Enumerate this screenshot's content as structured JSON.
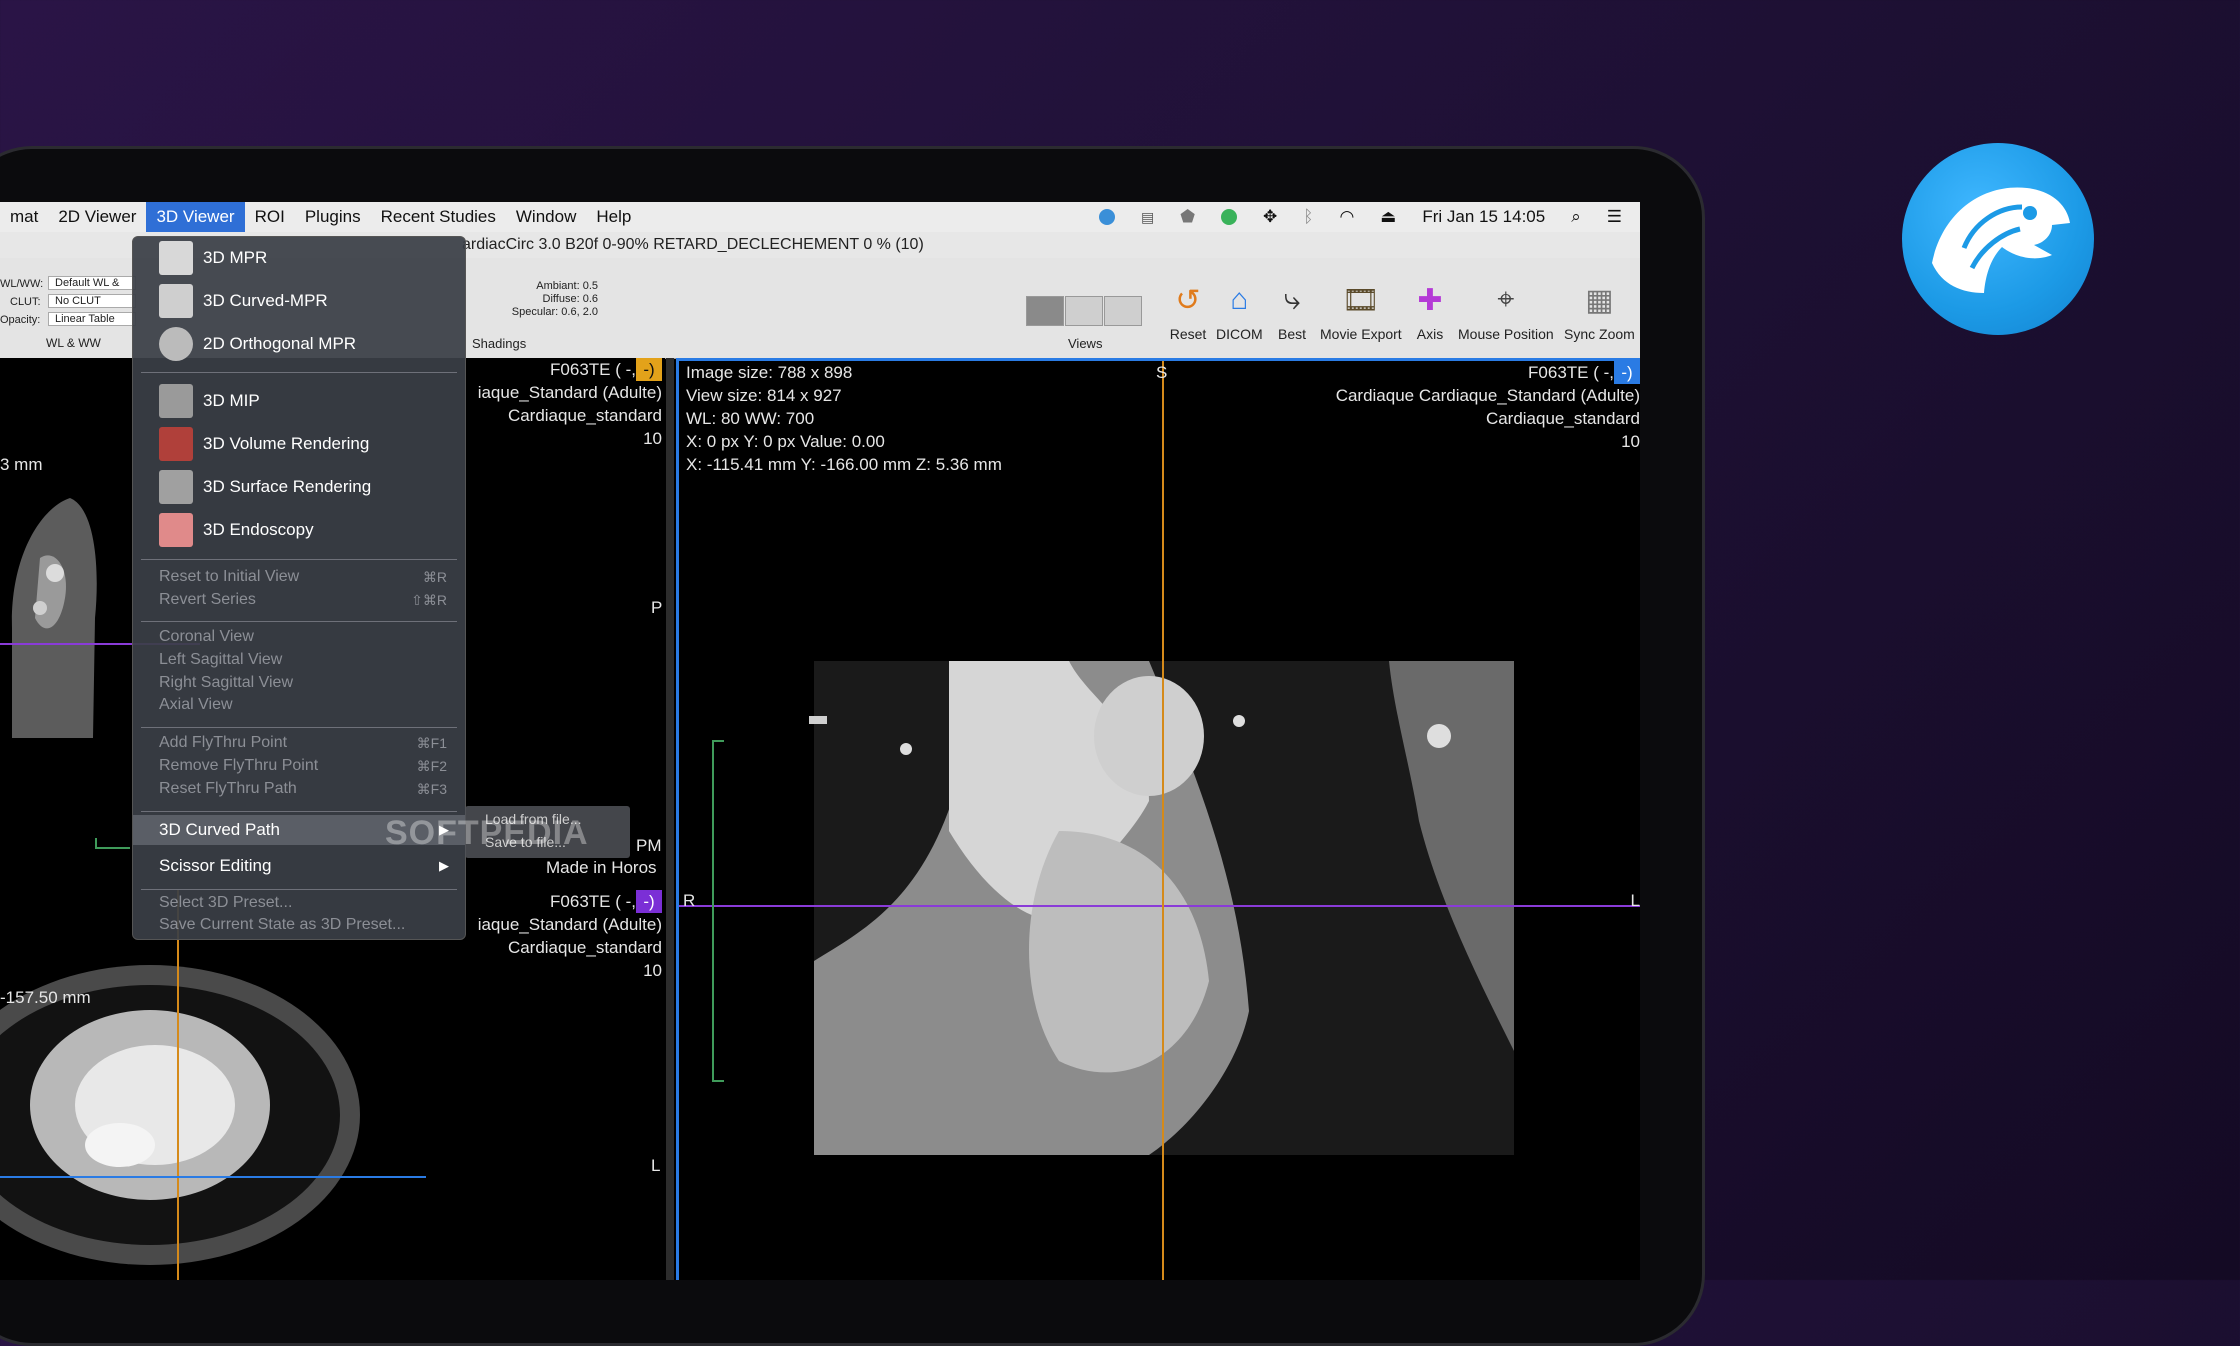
{
  "menubar": {
    "items": [
      "mat",
      "2D Viewer",
      "3D Viewer",
      "ROI",
      "Plugins",
      "Recent Studies",
      "Window",
      "Help"
    ],
    "clock": "Fri Jan 15  14:05"
  },
  "window": {
    "title": "ardiacCirc 3.0 B20f 0-90% RETARD_DECLECHEMENT 0 % (10)"
  },
  "toolbar": {
    "wl_labels": [
      "WL/WW:",
      "CLUT:",
      "Opacity:"
    ],
    "wl_values": [
      "Default WL &",
      "No CLUT",
      "Linear Table"
    ],
    "wl_group": "WL & WW",
    "shading_values": [
      "Ambiant: 0.5",
      "Diffuse: 0.6",
      "Specular: 0.6, 2.0"
    ],
    "shadings_label": "Shadings",
    "views_label": "Views",
    "tools": [
      "Reset",
      "DICOM",
      "Best",
      "Movie Export",
      "Axis",
      "Mouse Position",
      "Sync Zoom"
    ]
  },
  "menu": {
    "items": [
      {
        "label": "3D MPR",
        "color": "#d8d8d8"
      },
      {
        "label": "3D Curved-MPR",
        "color": "#cfcfcf"
      },
      {
        "label": "2D Orthogonal MPR",
        "color": "#bbbbbb"
      },
      {
        "label": "3D MIP",
        "color": "#9a9a9a"
      },
      {
        "label": "3D Volume Rendering",
        "color": "#b0403a"
      },
      {
        "label": "3D Surface Rendering",
        "color": "#a0a0a0"
      },
      {
        "label": "3D Endoscopy",
        "color": "#e08a8a"
      }
    ],
    "reset_initial": "Reset to Initial View",
    "reset_initial_sc": "⌘R",
    "revert_series": "Revert Series",
    "revert_series_sc": "⇧⌘R",
    "coronal": "Coronal View",
    "left_sag": "Left Sagittal View",
    "right_sag": "Right Sagittal View",
    "axial": "Axial View",
    "add_fly": "Add FlyThru Point",
    "add_fly_sc": "⌘F1",
    "remove_fly": "Remove FlyThru Point",
    "remove_fly_sc": "⌘F2",
    "reset_fly": "Reset FlyThru Path",
    "reset_fly_sc": "⌘F3",
    "curved_path": "3D Curved Path",
    "scissor": "Scissor Editing",
    "select_preset": "Select 3D Preset...",
    "save_preset": "Save Current State as 3D Preset..."
  },
  "submenu": {
    "load": "Load from file...",
    "save": "Save to file..."
  },
  "watermark": "SOFTPEDIA",
  "viewer_main": {
    "info": [
      "Image size: 788 x 898",
      "View size: 814 x 927",
      "WL: 80 WW: 700",
      "X: 0 px Y: 0 px Value: 0.00",
      "X: -115.41 mm Y: -166.00 mm Z: 5.36 mm"
    ],
    "right_info": [
      "F063TE (  -,",
      "Cardiaque Cardiaque_Standard (Adulte)",
      "Cardiaque_standard",
      "10"
    ],
    "badge": "-)",
    "top_marker": "S",
    "left_marker": "R",
    "right_marker": "L"
  },
  "viewer_top_left": {
    "info": [
      "F063TE (  -,",
      "iaque_Standard (Adulte)",
      "Cardiaque_standard",
      "10"
    ],
    "badge": "-)",
    "mm": "3 mm",
    "p_marker": "P",
    "pm_marker": "PM",
    "made_in": "Made in Horos"
  },
  "viewer_bottom_left": {
    "info": [
      "F063TE (  -,",
      "iaque_Standard (Adulte)",
      "Cardiaque_standard",
      "10"
    ],
    "badge": "-)",
    "mm": "-157.50 mm",
    "l_marker": "L"
  },
  "colors": {
    "accent": "#2f6fd6",
    "orange": "#e3a21a",
    "purple": "#7b2fd6",
    "blue": "#2a7be4",
    "cross_purple": "#8a3bd8",
    "cross_orange": "#d58a1a"
  },
  "logo_icon": "falcon-icon"
}
